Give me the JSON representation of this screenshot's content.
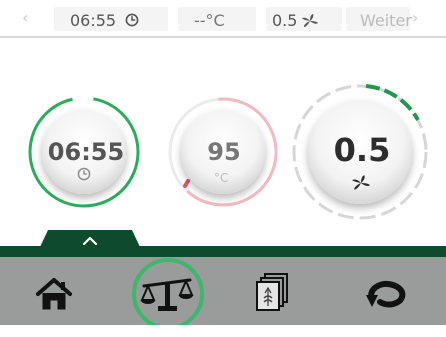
{
  "topbar": {
    "prev_arrow": "‹",
    "time_value": "06:55",
    "time_icon": "clock-icon",
    "temperature_value": "--°C",
    "fan_value": "0.5",
    "fan_icon": "fan-icon",
    "next_label": "Weiter",
    "next_arrow": "›"
  },
  "dials": {
    "timer": {
      "value": "06:55",
      "icon": "clock-icon",
      "accent_color": "#2bac5b"
    },
    "temperature": {
      "value": "95",
      "unit": "°C",
      "accent_color": "#e88c96"
    },
    "fan": {
      "value": "0.5",
      "icon": "fan-icon",
      "accent_color": "#1e9a49"
    }
  },
  "nav": {
    "pullup_icon": "chevron-up-icon",
    "items": [
      {
        "id": "home",
        "icon": "home-icon",
        "active": false
      },
      {
        "id": "scale",
        "icon": "scale-icon",
        "active": true
      },
      {
        "id": "log",
        "icon": "log-icon",
        "active": false
      },
      {
        "id": "reset",
        "icon": "reset-icon",
        "active": false
      }
    ],
    "highlight_color": "#3eb66b",
    "bar_color": "#999c9b",
    "stripe_color": "#0e4a2c"
  }
}
